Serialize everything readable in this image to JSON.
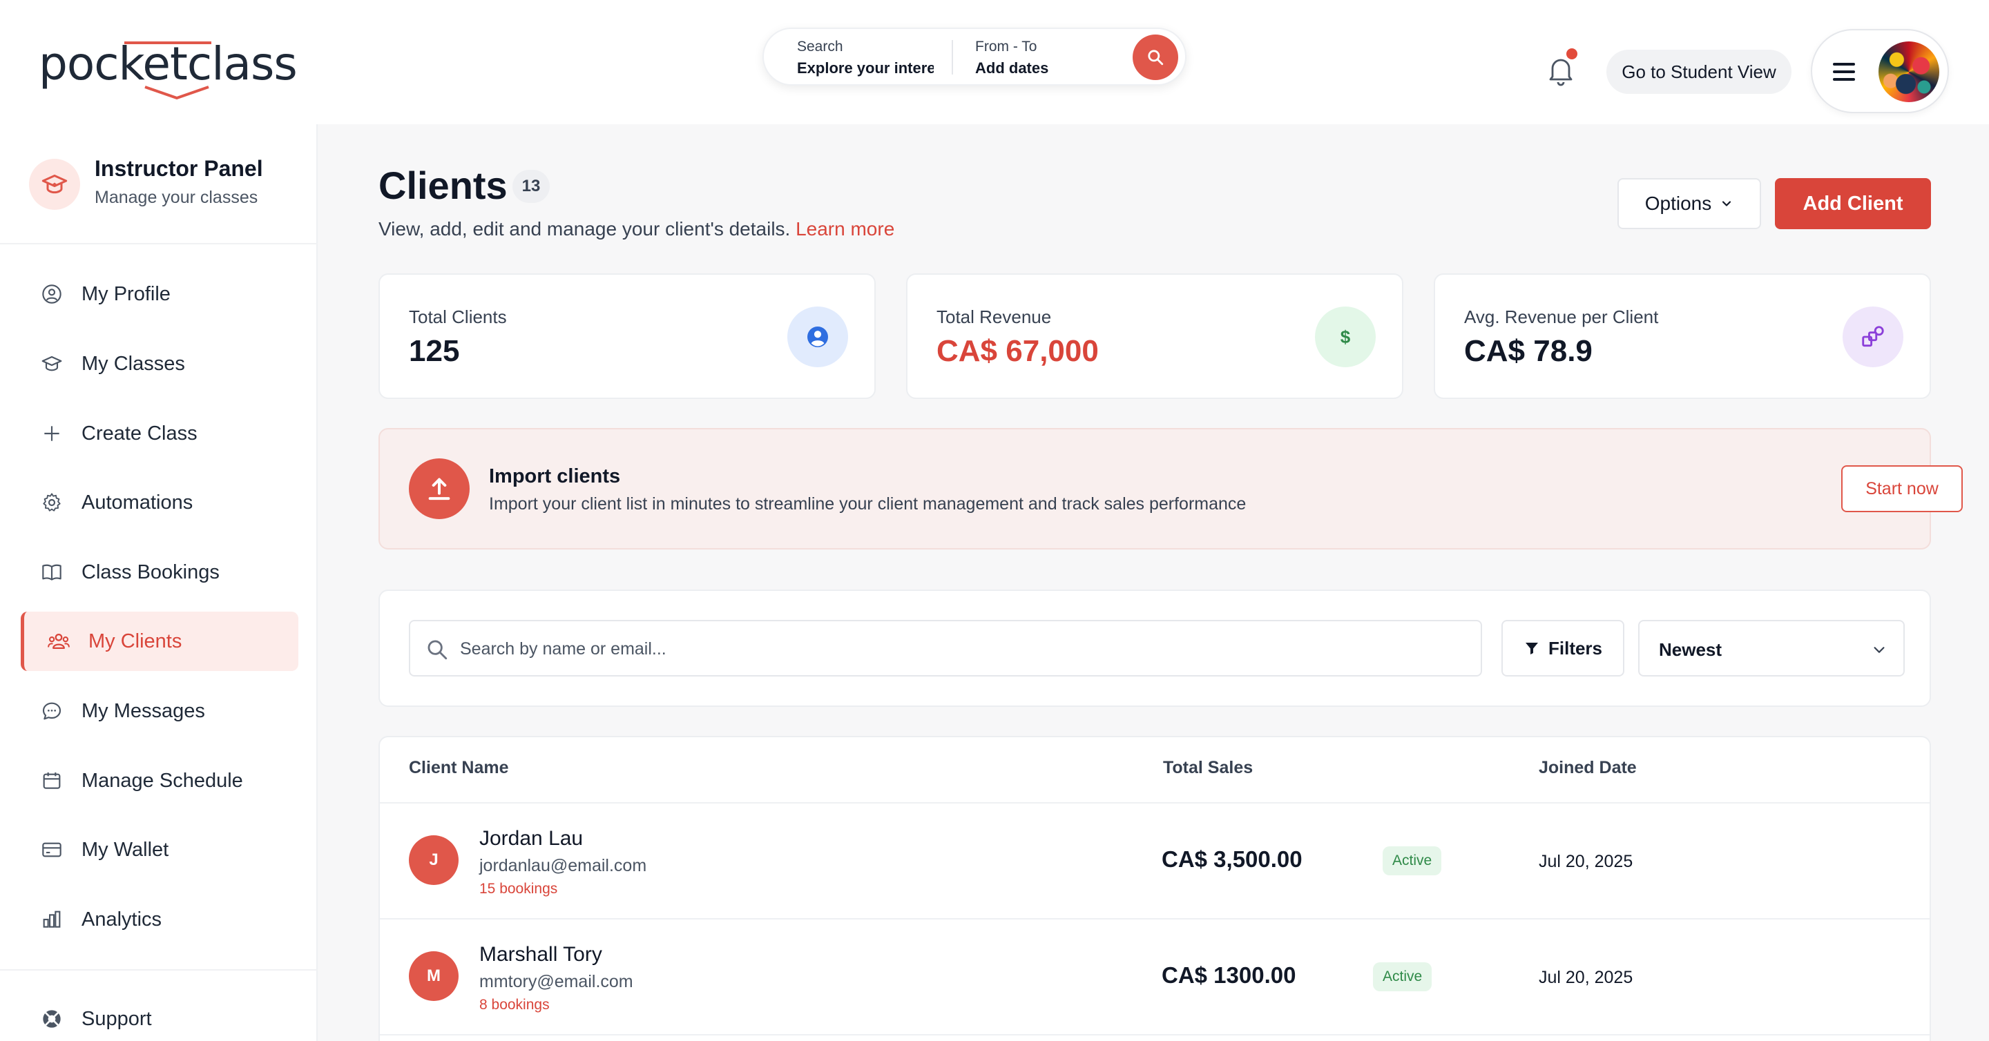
{
  "header": {
    "logo_text": "pocketclass",
    "search": {
      "label": "Search",
      "value": "Explore your intere",
      "date_label": "From - To",
      "date_value": "Add dates"
    },
    "student_view_label": "Go to Student View"
  },
  "sidebar": {
    "panel_title": "Instructor Panel",
    "panel_subtitle": "Manage your classes",
    "items": [
      {
        "label": "My Profile",
        "icon": "user-circle-icon"
      },
      {
        "label": "My Classes",
        "icon": "graduation-cap-icon"
      },
      {
        "label": "Create Class",
        "icon": "plus-icon"
      },
      {
        "label": "Automations",
        "icon": "gear-icon"
      },
      {
        "label": "Class Bookings",
        "icon": "book-open-icon"
      },
      {
        "label": "My Clients",
        "icon": "users-icon",
        "active": true
      },
      {
        "label": "My Messages",
        "icon": "chat-bubble-icon"
      },
      {
        "label": "Manage Schedule",
        "icon": "calendar-icon"
      },
      {
        "label": "My Wallet",
        "icon": "credit-card-icon"
      },
      {
        "label": "Analytics",
        "icon": "bar-chart-icon"
      }
    ],
    "support_label": "Support"
  },
  "main": {
    "title": "Clients",
    "count": "13",
    "description": "View, add, edit and manage your client's details.",
    "learn_more": "Learn more",
    "options_label": "Options",
    "add_client_label": "Add Client",
    "stats": [
      {
        "label": "Total Clients",
        "value": "125",
        "icon": "user-circle-icon"
      },
      {
        "label": "Total Revenue",
        "value": "CA$ 67,000",
        "icon": "dollar-icon"
      },
      {
        "label": "Avg. Revenue per Client",
        "value": "CA$ 78.9",
        "icon": "shapes-icon"
      }
    ],
    "import": {
      "title": "Import clients",
      "subtitle": "Import your client list in minutes to streamline your client management and track sales performance",
      "button": "Start now"
    },
    "filter": {
      "search_placeholder": "Search by name or email...",
      "filters_label": "Filters",
      "sort_value": "Newest"
    },
    "table": {
      "columns": [
        "Client Name",
        "Total Sales",
        "Joined Date"
      ],
      "rows": [
        {
          "initial": "J",
          "name": "Jordan Lau",
          "email": "jordanlau@email.com",
          "bookings": "15 bookings",
          "sales": "CA$ 3,500.00",
          "status": "Active",
          "joined": "Jul 20, 2025"
        },
        {
          "initial": "M",
          "name": "Marshall Tory",
          "email": "mmtory@email.com",
          "bookings": "8 bookings",
          "sales": "CA$ 1300.00",
          "status": "Active",
          "joined": "Jul 20, 2025"
        }
      ]
    }
  },
  "colors": {
    "brand": "#e0574a",
    "brand_dark": "#d9453a",
    "active_bg": "#fdecea",
    "success_bg": "#e6f6ea",
    "success_text": "#2f8a48"
  }
}
